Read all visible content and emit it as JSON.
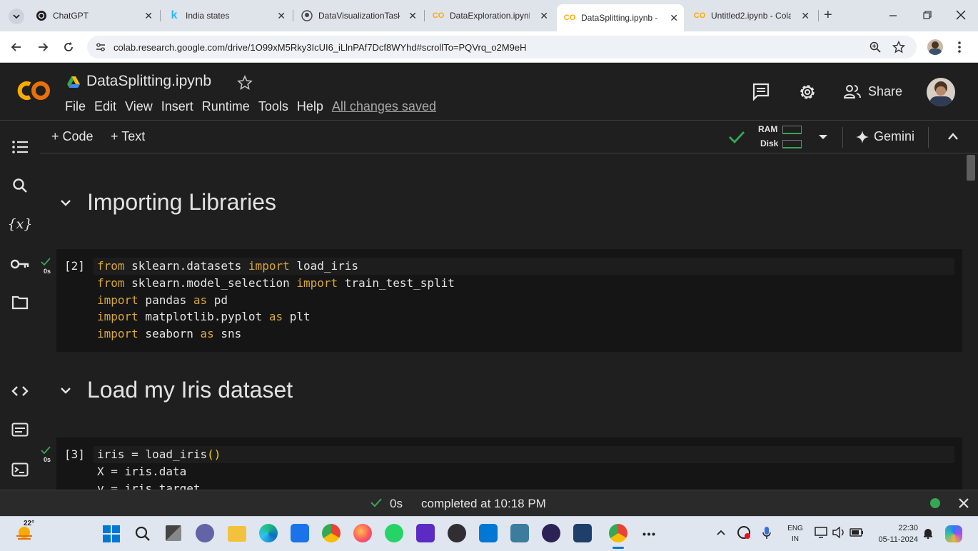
{
  "browser": {
    "tabs": [
      {
        "title": "ChatGPT",
        "icon": "chatgpt-icon",
        "active": false
      },
      {
        "title": "India states",
        "icon": "kaggle-icon",
        "active": false
      },
      {
        "title": "DataVisualizationTask",
        "icon": "github-icon",
        "active": false
      },
      {
        "title": "DataExploration.ipynb",
        "icon": "colab-icon",
        "active": false
      },
      {
        "title": "DataSplitting.ipynb -",
        "icon": "colab-icon",
        "active": true
      },
      {
        "title": "Untitled2.ipynb - Cola",
        "icon": "colab-icon",
        "active": false
      }
    ],
    "new_tab": "+",
    "close_glyph": "✕",
    "url": "colab.research.google.com/drive/1O99xM5Rky3IcUI6_iLlnPAf7Dcf8WYhd#scrollTo=PQVrq_o2M9eH"
  },
  "colab": {
    "notebook_title": "DataSplitting.ipynb",
    "menu": [
      "File",
      "Edit",
      "View",
      "Insert",
      "Runtime",
      "Tools",
      "Help"
    ],
    "saved_status": "All changes saved",
    "share_label": "Share",
    "add_code_label": "+ Code",
    "add_text_label": "+ Text",
    "ram_label": "RAM",
    "disk_label": "Disk",
    "gemini_label": "Gemini",
    "accent_orange": "#f9ab00",
    "check_green": "#34a853"
  },
  "notebook": {
    "sections": [
      {
        "title": "Importing Libraries"
      },
      {
        "title": "Load my Iris dataset"
      }
    ],
    "cells": [
      {
        "exec_count": "[2]",
        "duration": "0s",
        "lines": [
          "from sklearn.datasets import load_iris",
          "from sklearn.model_selection import train_test_split",
          "import pandas as pd",
          "import matplotlib.pyplot as plt",
          "import seaborn as sns"
        ]
      },
      {
        "exec_count": "[3]",
        "duration": "0s",
        "lines": [
          "iris = load_iris()",
          "X = iris.data",
          "y = iris.target"
        ]
      }
    ]
  },
  "statusbar": {
    "duration": "0s",
    "completed": "completed at 10:18 PM"
  },
  "taskbar": {
    "weather_temp": "22°",
    "lang_top": "ENG",
    "lang_bottom": "IN",
    "time": "22:30",
    "date": "05-11-2024"
  }
}
